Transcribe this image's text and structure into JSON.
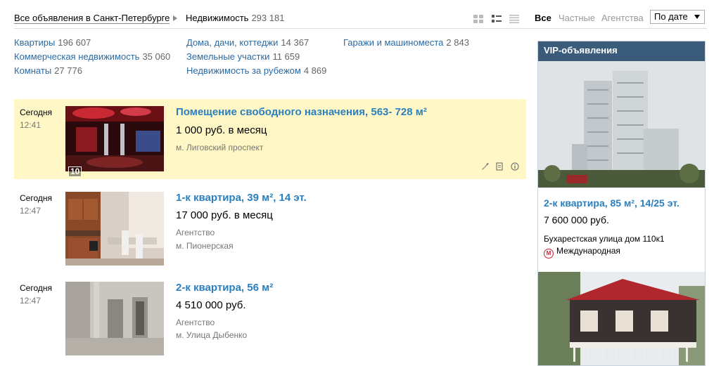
{
  "breadcrumb": {
    "home": "Все объявления в Санкт-Петербурге",
    "current": "Недвижимость",
    "current_count": "293 181"
  },
  "view_icons": [
    "grid-view-icon",
    "list-view-icon",
    "compact-view-icon"
  ],
  "filters": {
    "all": "Все",
    "private": "Частные",
    "agency": "Агентства",
    "sort": "По дате"
  },
  "categories": [
    {
      "label": "Квартиры",
      "count": "196 607"
    },
    {
      "label": "Коммерческая недвижимость",
      "count": "35 060"
    },
    {
      "label": "Комнаты",
      "count": "27 776"
    },
    {
      "label": "Дома, дачи, коттеджи",
      "count": "14 367"
    },
    {
      "label": "Земельные участки",
      "count": "11 659"
    },
    {
      "label": "Недвижимость за рубежом",
      "count": "4 869"
    },
    {
      "label": "Гаражи и машиноместа",
      "count": "2 843"
    }
  ],
  "listings": [
    {
      "date": "Сегодня",
      "time": "12:41",
      "title": "Помещение свободного назначения, 563- 728 м²",
      "price": "1 000 руб. в месяц",
      "seller": "",
      "location": "м. Лиговский проспект",
      "photo_count": "10",
      "highlighted": true
    },
    {
      "date": "Сегодня",
      "time": "12:47",
      "title": "1-к квартира, 39 м², 14 эт.",
      "price": "17 000 руб. в месяц",
      "seller": "Агентство",
      "location": "м. Пионерская",
      "photo_count": "",
      "highlighted": false
    },
    {
      "date": "Сегодня",
      "time": "12:47",
      "title": "2-к квартира, 56 м²",
      "price": "4 510 000 руб.",
      "seller": "Агентство",
      "location": "м. Улица Дыбенко",
      "photo_count": "",
      "highlighted": false
    }
  ],
  "tool_icons": [
    "pencil-icon",
    "document-icon",
    "info-icon"
  ],
  "vip": {
    "header": "VIP-объявления",
    "title": "2-к квартира, 85 м², 14/25 эт.",
    "price": "7 600 000 руб.",
    "address": "Бухарестская улица дом 110к1",
    "metro": "Международная",
    "metro_icon_letter": "M"
  },
  "colors": {
    "accent_link": "#2a6aa5",
    "title_link": "#2a7fbf",
    "highlight": "#fff8c6",
    "vip_header": "#3b5b7a"
  }
}
